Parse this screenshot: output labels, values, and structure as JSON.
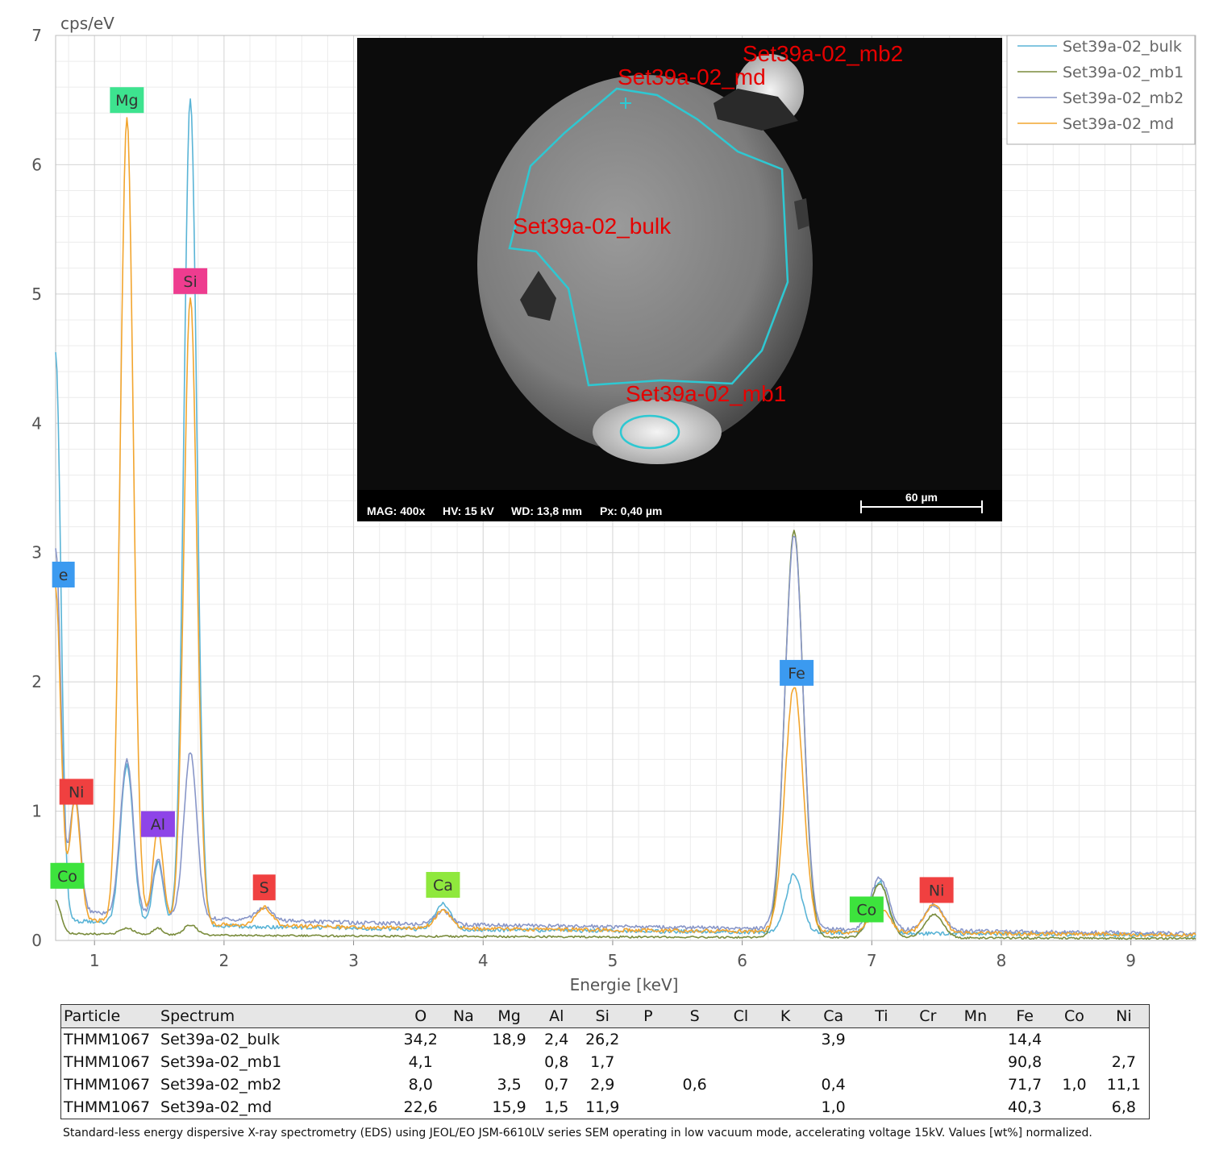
{
  "chart_data": {
    "type": "line",
    "xlabel": "Energie [keV]",
    "ylabel": "cps/eV",
    "xlim": [
      0.7,
      9.5
    ],
    "ylim": [
      0,
      7
    ],
    "x_ticks": [
      "1",
      "2",
      "3",
      "4",
      "5",
      "6",
      "7",
      "8",
      "9"
    ],
    "y_ticks": [
      "0",
      "1",
      "2",
      "3",
      "4",
      "5",
      "6",
      "7"
    ],
    "grid": true,
    "legend_position": "top-right",
    "series": [
      {
        "name": "Set39a-02_bulk",
        "color": "#5ab4d6",
        "baseline": 0.09,
        "peaks": [
          [
            0.7,
            4.4,
            0.04
          ],
          [
            1.25,
            1.22,
            0.05
          ],
          [
            1.49,
            0.48,
            0.04
          ],
          [
            1.74,
            6.4,
            0.05
          ],
          [
            3.69,
            0.2,
            0.06
          ],
          [
            6.4,
            0.45,
            0.06
          ],
          [
            7.06,
            0.4,
            0.06
          ]
        ]
      },
      {
        "name": "Set39a-02_mb1",
        "color": "#7a8c3c",
        "baseline": 0.03,
        "peaks": [
          [
            0.7,
            0.25,
            0.04
          ],
          [
            1.25,
            0.05,
            0.05
          ],
          [
            1.49,
            0.05,
            0.04
          ],
          [
            1.74,
            0.08,
            0.05
          ],
          [
            6.4,
            3.15,
            0.07
          ],
          [
            7.06,
            0.42,
            0.07
          ],
          [
            7.48,
            0.18,
            0.07
          ]
        ]
      },
      {
        "name": "Set39a-02_mb2",
        "color": "#8896c8",
        "baseline": 0.14,
        "peaks": [
          [
            0.7,
            2.8,
            0.04
          ],
          [
            0.85,
            0.9,
            0.04
          ],
          [
            1.25,
            1.2,
            0.05
          ],
          [
            1.49,
            0.44,
            0.04
          ],
          [
            1.74,
            1.28,
            0.05
          ],
          [
            2.31,
            0.1,
            0.06
          ],
          [
            3.69,
            0.1,
            0.06
          ],
          [
            6.4,
            3.05,
            0.07
          ],
          [
            7.06,
            0.4,
            0.07
          ],
          [
            7.48,
            0.2,
            0.07
          ]
        ]
      },
      {
        "name": "Set39a-02_md",
        "color": "#f2a52e",
        "baseline": 0.1,
        "peaks": [
          [
            0.7,
            2.55,
            0.04
          ],
          [
            0.85,
            0.92,
            0.04
          ],
          [
            1.25,
            6.22,
            0.05
          ],
          [
            1.49,
            0.72,
            0.04
          ],
          [
            1.74,
            4.85,
            0.05
          ],
          [
            2.31,
            0.14,
            0.06
          ],
          [
            3.69,
            0.14,
            0.06
          ],
          [
            6.4,
            1.9,
            0.07
          ],
          [
            7.06,
            0.2,
            0.07
          ],
          [
            7.48,
            0.22,
            0.07
          ]
        ]
      }
    ],
    "peak_labels": [
      {
        "text": "Mg",
        "x": 1.25,
        "y": 6.5,
        "color": "#3de38f"
      },
      {
        "text": "Si",
        "x": 1.74,
        "y": 5.1,
        "color": "#ee3c8f"
      },
      {
        "text": "e",
        "x": 0.76,
        "y": 2.83,
        "color": "#3b9af0"
      },
      {
        "text": "Ni",
        "x": 0.86,
        "y": 1.15,
        "color": "#f04040"
      },
      {
        "text": "Al",
        "x": 1.49,
        "y": 0.9,
        "color": "#8e44e8"
      },
      {
        "text": "Co",
        "x": 0.79,
        "y": 0.5,
        "color": "#3de33d"
      },
      {
        "text": "S",
        "x": 2.31,
        "y": 0.41,
        "color": "#f04040"
      },
      {
        "text": "Ca",
        "x": 3.69,
        "y": 0.43,
        "color": "#8fe83d"
      },
      {
        "text": "Fe",
        "x": 6.42,
        "y": 2.07,
        "color": "#3b9af0"
      },
      {
        "text": "Co",
        "x": 6.96,
        "y": 0.24,
        "color": "#3de33d"
      },
      {
        "text": "Ni",
        "x": 7.5,
        "y": 0.39,
        "color": "#f04040"
      }
    ]
  },
  "inset": {
    "labels": {
      "mb2": "Set39a-02_mb2",
      "md": "Set39a-02_md",
      "bulk": "Set39a-02_bulk",
      "mb1": "Set39a-02_mb1"
    },
    "mag": "MAG: 400x",
    "hv": "HV: 15 kV",
    "wd": "WD: 13,8 mm",
    "px": "Px: 0,40 µm",
    "scale": "60 µm"
  },
  "table": {
    "headers": [
      "Particle",
      "Spectrum",
      "O",
      "Na",
      "Mg",
      "Al",
      "Si",
      "P",
      "S",
      "Cl",
      "K",
      "Ca",
      "Ti",
      "Cr",
      "Mn",
      "Fe",
      "Co",
      "Ni"
    ],
    "rows": [
      [
        "THMM1067",
        "Set39a-02_bulk",
        "34,2",
        "",
        "18,9",
        "2,4",
        "26,2",
        "",
        "",
        "",
        "",
        "3,9",
        "",
        "",
        "",
        "14,4",
        "",
        ""
      ],
      [
        "THMM1067",
        "Set39a-02_mb1",
        "4,1",
        "",
        "",
        "0,8",
        "1,7",
        "",
        "",
        "",
        "",
        "",
        "",
        "",
        "",
        "90,8",
        "",
        "2,7"
      ],
      [
        "THMM1067",
        "Set39a-02_mb2",
        "8,0",
        "",
        "3,5",
        "0,7",
        "2,9",
        "",
        "0,6",
        "",
        "",
        "0,4",
        "",
        "",
        "",
        "71,7",
        "1,0",
        "11,1"
      ],
      [
        "THMM1067",
        "Set39a-02_md",
        "22,6",
        "",
        "15,9",
        "1,5",
        "11,9",
        "",
        "",
        "",
        "",
        "1,0",
        "",
        "",
        "",
        "40,3",
        "",
        "6,8"
      ]
    ]
  },
  "footnote": "Standard-less energy dispersive X-ray spectrometry (EDS) using JEOL/EO JSM-6610LV series SEM operating in low vacuum mode, accelerating voltage 15kV. Values [wt%] normalized."
}
